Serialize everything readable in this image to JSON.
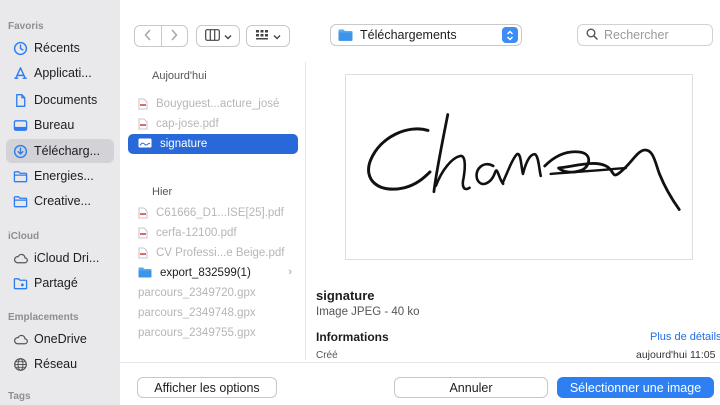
{
  "sidebar": {
    "favorites_label": "Favoris",
    "icloud_label": "iCloud",
    "locations_label": "Emplacements",
    "tags_label": "Tags",
    "favorites": [
      {
        "label": "Récents",
        "icon": "clock-icon"
      },
      {
        "label": "Applicati...",
        "icon": "applications-icon"
      },
      {
        "label": "Documents",
        "icon": "document-icon"
      },
      {
        "label": "Bureau",
        "icon": "desktop-icon"
      },
      {
        "label": "Télécharg...",
        "icon": "download-icon",
        "selected": true
      },
      {
        "label": "Energies...",
        "icon": "folder-icon"
      },
      {
        "label": "Creative...",
        "icon": "folder-icon"
      }
    ],
    "icloud": [
      {
        "label": "iCloud Dri...",
        "icon": "cloud-icon"
      },
      {
        "label": "Partagé",
        "icon": "shared-folder-icon"
      }
    ],
    "locations": [
      {
        "label": "OneDrive",
        "icon": "cloud-icon"
      },
      {
        "label": "Réseau",
        "icon": "network-globe-icon"
      }
    ]
  },
  "toolbar": {
    "location": "Téléchargements",
    "search_placeholder": "Rechercher"
  },
  "file_list": {
    "today_header": "Aujourd'hui",
    "yesterday_header": "Hier",
    "today": [
      {
        "name": "Bouyguest...acture_josé",
        "state": "disabled"
      },
      {
        "name": "cap-jose.pdf",
        "state": "disabled"
      },
      {
        "name": "signature",
        "state": "selected"
      }
    ],
    "yesterday": [
      {
        "name": "C61666_D1...ISE[25].pdf",
        "state": "disabled"
      },
      {
        "name": "cerfa-12100.pdf",
        "state": "disabled"
      },
      {
        "name": "CV Professi...e Beige.pdf",
        "state": "disabled"
      },
      {
        "name": "export_832599(1)",
        "state": "folder"
      },
      {
        "name": "parcours_2349720.gpx",
        "state": "disabled"
      },
      {
        "name": "parcours_2349748.gpx",
        "state": "disabled"
      },
      {
        "name": "parcours_2349755.gpx",
        "state": "disabled"
      }
    ]
  },
  "preview": {
    "name": "signature",
    "type": "Image JPEG - 40 ko",
    "info_title": "Informations",
    "more_details": "Plus de détails",
    "created_label": "Créé",
    "created_value": "aujourd'hui 11:05"
  },
  "buttons": {
    "options": "Afficher les options",
    "cancel": "Annuler",
    "select": "Sélectionner une image"
  },
  "colors": {
    "accent": "#2e7ff1",
    "selection": "#2868d8",
    "sidebar_bg": "#e9e8ea"
  }
}
